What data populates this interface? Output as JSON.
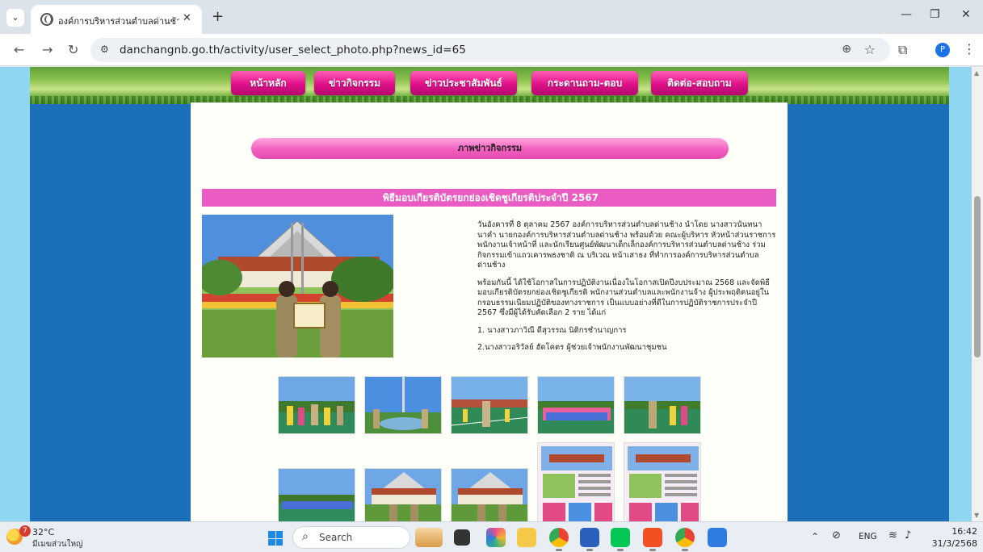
{
  "browser": {
    "tab_title": "องค์การบริหารส่วนตำบลด่านช้าง อำเภ",
    "tab_close": "✕",
    "new_tab": "+",
    "url": "danchangnb.go.th/activity/user_select_photo.php?news_id=65",
    "profile_initial": "P",
    "controls": {
      "minimize": "—",
      "maximize": "❐",
      "close": "✕"
    }
  },
  "site": {
    "menu": [
      {
        "label": "หน้าหลัก"
      },
      {
        "label": "ข่าวกิจกรรม"
      },
      {
        "label": "ข่าวประชาสัมพันธ์"
      },
      {
        "label": "กระดานถาม-ตอบ"
      },
      {
        "label": "ติดต่อ-สอบถาม"
      }
    ],
    "section_title": "ภาพข่าวกิจกรรม",
    "news_title": "พิธีมอบเกียรติบัตรยกย่องเชิดชูเกียรติประจำปี 2567",
    "paragraphs": [
      "วันอังคารที่ 8 ตุลาคม 2567 องค์การบริหารส่วนตำบลด่านช้าง นำโดย นางสาวนันทนา นาคำ นายกองค์การบริหารส่วนตำบลด่านช้าง พร้อมด้วย คณะผู้บริหาร หัวหน้าส่วนราชการ พนักงานเจ้าหน้าที่ และนักเรียนศูนย์พัฒนาเด็กเล็กองค์การบริหารส่วนตำบลด่านช้าง ร่วมกิจกรรมเข้าแถวเคารพธงชาติ ณ บริเวณ หน้าเสาธง ที่ทำการองค์การบริหารส่วนตำบลด่านช้าง",
      "พร้อมกันนี้ ได้ใช้โอกาสในการปฏิบัติงานเนื่องในโอกาสเปิดปีงบประมาณ 2568 และจัดพิธีมอบเกียรติบัตรยกย่องเชิดชูเกียรติ พนักงานส่วนตำบลและพนักงานจ้าง ผู้ประพฤติตนอยู่ในกรอบธรรมเนียมปฏิบัติของทางราชการ เป็นแบบอย่างที่ดีในการปฏิบัติราชการประจำปี 2567 ซึ่งมีผู้ได้รับคัดเลือก 2 ราย ได้แก่",
      "1. นางสาวภาวิณี ดีสุวรรณ นิติกรชำนาญการ",
      "2.นางสาวอริวัลย์ ฮัดโคตร ผู้ช่วยเจ้าพนักงานพัฒนาชุมชน"
    ]
  },
  "taskbar": {
    "weather_badge": "7",
    "temperature": "32°C",
    "weather_desc": "มีเมฆส่วนใหญ่",
    "search_label": "Search",
    "language": "ENG",
    "time": "16:42",
    "date": "31/3/2568"
  },
  "colors": {
    "page_blue": "#1b6fb9",
    "pink_accent": "#ea5cc3",
    "menu_magenta": "#e0108a"
  }
}
